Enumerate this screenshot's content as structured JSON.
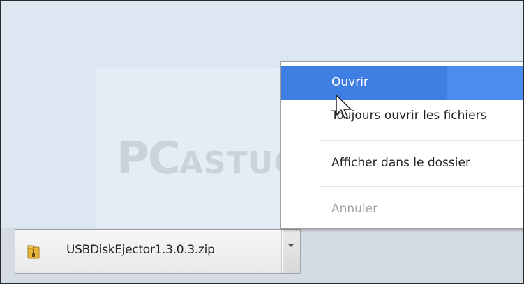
{
  "downloads": {
    "items": [
      {
        "file_name": "USBDiskEjector1.3.0.3.zip",
        "icon": "zip-archive-icon"
      }
    ]
  },
  "context_menu": {
    "items": [
      {
        "label": "Ouvrir",
        "state": "highlighted"
      },
      {
        "label": "Toujours ouvrir les fichiers",
        "state": "normal"
      },
      {
        "label": "Afficher dans le dossier",
        "state": "normal"
      },
      {
        "label": "Annuler",
        "state": "disabled"
      }
    ]
  },
  "watermark": {
    "brand_prefix": "PC",
    "brand_suffix": "ASTUCES"
  },
  "colors": {
    "menu_highlight": "#4a8cf0",
    "page_background": "#dce7f2",
    "download_bar": "#d5dbe2",
    "disabled_text": "#a3a3a3"
  }
}
